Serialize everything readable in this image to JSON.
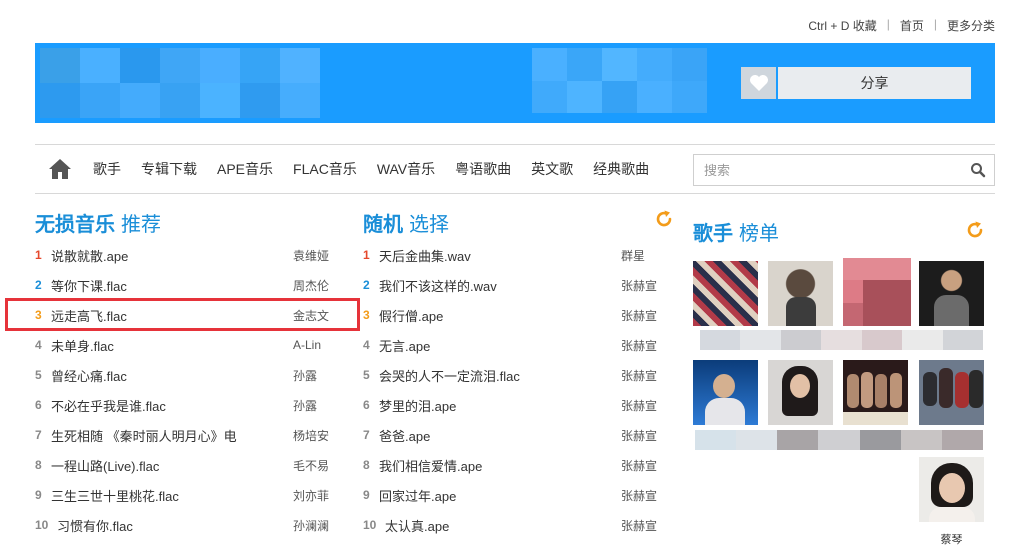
{
  "top_links": {
    "bookmark": "Ctrl + D 收藏",
    "home": "首页",
    "more": "更多分类",
    "separator": "|"
  },
  "banner": {
    "share_label": "分享",
    "heart_icon": "heart-icon"
  },
  "nav": {
    "items": [
      "歌手",
      "专辑下载",
      "APE音乐",
      "FLAC音乐",
      "WAV音乐",
      "粤语歌曲",
      "英文歌",
      "经典歌曲"
    ],
    "search_placeholder": "搜索"
  },
  "sections": {
    "recommend": {
      "title_main": "无损音乐",
      "title_sub": "推荐"
    },
    "random": {
      "title_main": "随机",
      "title_sub": "选择"
    },
    "singers": {
      "title_main": "歌手",
      "title_sub": "榜单"
    }
  },
  "recommend_list": [
    {
      "num": "1",
      "title": "说散就散.ape",
      "artist": "袁维娅"
    },
    {
      "num": "2",
      "title": "等你下课.flac",
      "artist": "周杰伦"
    },
    {
      "num": "3",
      "title": "远走高飞.flac",
      "artist": "金志文"
    },
    {
      "num": "4",
      "title": "未单身.flac",
      "artist": "A-Lin"
    },
    {
      "num": "5",
      "title": "曾经心痛.flac",
      "artist": "孙露"
    },
    {
      "num": "6",
      "title": "不必在乎我是谁.flac",
      "artist": "孙露"
    },
    {
      "num": "7",
      "title": "生死相随 《秦时丽人明月心》电",
      "artist": "杨培安"
    },
    {
      "num": "8",
      "title": "一程山路(Live).flac",
      "artist": "毛不易"
    },
    {
      "num": "9",
      "title": "三生三世十里桃花.flac",
      "artist": "刘亦菲"
    },
    {
      "num": "10",
      "title": "习惯有你.flac",
      "artist": "孙澜澜"
    }
  ],
  "random_list": [
    {
      "num": "1",
      "title": "天后金曲集.wav",
      "artist": "群星"
    },
    {
      "num": "2",
      "title": "我们不该这样的.wav",
      "artist": "张赫宣"
    },
    {
      "num": "3",
      "title": "假行僧.ape",
      "artist": "张赫宣"
    },
    {
      "num": "4",
      "title": "无言.ape",
      "artist": "张赫宣"
    },
    {
      "num": "5",
      "title": "会哭的人不一定流泪.flac",
      "artist": "张赫宣"
    },
    {
      "num": "6",
      "title": "梦里的泪.ape",
      "artist": "张赫宣"
    },
    {
      "num": "7",
      "title": "爸爸.ape",
      "artist": "张赫宣"
    },
    {
      "num": "8",
      "title": "我们相信爱情.ape",
      "artist": "张赫宣"
    },
    {
      "num": "9",
      "title": "回家过年.ape",
      "artist": "张赫宣"
    },
    {
      "num": "10",
      "title": "太认真.ape",
      "artist": "张赫宣"
    }
  ],
  "singer_captions": {
    "last": "蔡琴"
  },
  "colors": {
    "accent": "#1a8ed8",
    "banner": "#1a9cff",
    "rank_top": "#e5482c",
    "rank_third": "#f39c1a",
    "refresh": "#f39c1a",
    "highlight_box": "#e6333a"
  }
}
